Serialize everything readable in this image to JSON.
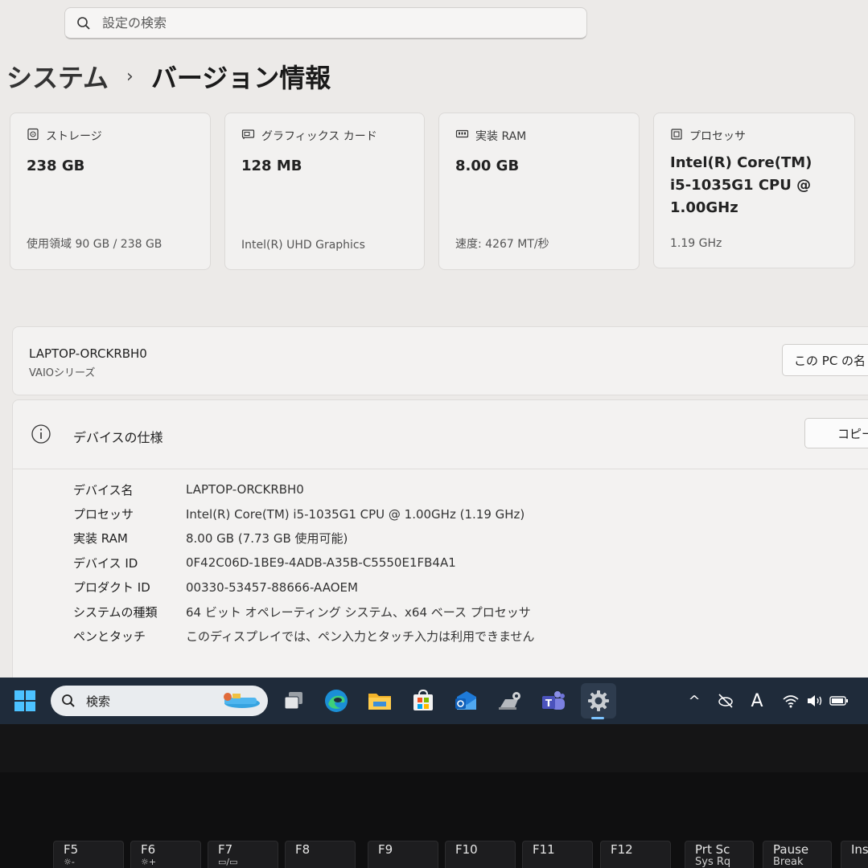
{
  "search": {
    "placeholder": "設定の検索"
  },
  "breadcrumb": {
    "parent": "システム",
    "separator": "›",
    "current": "バージョン情報"
  },
  "spec_cards": [
    {
      "label": "ストレージ",
      "value": "238 GB",
      "sub": "使用領域 90 GB / 238 GB",
      "icon": "storage-icon"
    },
    {
      "label": "グラフィックス カード",
      "value": "128 MB",
      "sub": "Intel(R) UHD Graphics",
      "icon": "graphics-card-icon"
    },
    {
      "label": "実装 RAM",
      "value": "8.00 GB",
      "sub": "速度: 4267 MT/秒",
      "icon": "ram-icon"
    },
    {
      "label": "プロセッサ",
      "value": "Intel(R) Core(TM) i5-1035G1 CPU @ 1.00GHz",
      "sub": "1.19 GHz",
      "icon": "processor-icon"
    }
  ],
  "device": {
    "name": "LAPTOP-ORCKRBH0",
    "series": "VAIOシリーズ",
    "rename_label": "この PC の名"
  },
  "device_specs": {
    "title": "デバイスの仕様",
    "copy_label": "コピー",
    "rows": [
      {
        "key": "デバイス名",
        "value": "LAPTOP-ORCKRBH0"
      },
      {
        "key": "プロセッサ",
        "value": "Intel(R) Core(TM) i5-1035G1 CPU @ 1.00GHz (1.19 GHz)"
      },
      {
        "key": "実装 RAM",
        "value": "8.00 GB (7.73 GB 使用可能)"
      },
      {
        "key": "デバイス ID",
        "value": "0F42C06D-1BE9-4ADB-A35B-C5550E1FB4A1"
      },
      {
        "key": "プロダクト ID",
        "value": "00330-53457-88666-AAOEM"
      },
      {
        "key": "システムの種類",
        "value": "64 ビット オペレーティング システム、x64 ベース プロセッサ"
      },
      {
        "key": "ペンとタッチ",
        "value": "このディスプレイでは、ペン入力とタッチ入力は利用できません"
      }
    ]
  },
  "taskbar": {
    "search_label": "検索",
    "apps": [
      "windows-start-icon",
      "task-view-icon",
      "edge-icon",
      "file-explorer-icon",
      "store-icon",
      "outlook-icon",
      "vaio-control-icon",
      "teams-icon",
      "settings-icon"
    ],
    "tray": {
      "chevron": "^",
      "ime": "A"
    }
  },
  "keys": [
    {
      "label": "F5",
      "glyph": "☼-"
    },
    {
      "label": "F6",
      "glyph": "☼+"
    },
    {
      "label": "F7",
      "glyph": "▭/▭"
    },
    {
      "label": "F8",
      "glyph": ""
    },
    {
      "label": "F9",
      "glyph": ""
    },
    {
      "label": "F10",
      "glyph": ""
    },
    {
      "label": "F11",
      "glyph": ""
    },
    {
      "label": "F12",
      "glyph": ""
    },
    {
      "label": "Prt Sc",
      "glyph": "Sys Rq"
    },
    {
      "label": "Pause",
      "glyph": "Break"
    },
    {
      "label": "Ins",
      "glyph": ""
    }
  ],
  "colors": {
    "window_bg": "#eceae8",
    "taskbar_bg": "#1f2b3a",
    "accent": "#7cc3ff"
  }
}
